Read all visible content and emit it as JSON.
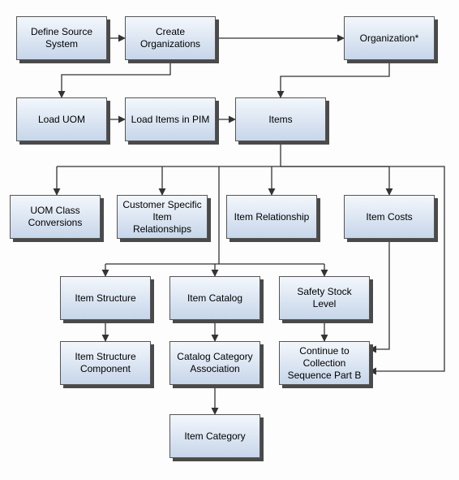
{
  "nodes": {
    "define_source_system": "Define Source System",
    "create_orgs": "Create Organizations",
    "organization": "Organization*",
    "load_uom": "Load UOM",
    "load_items_pim": "Load Items in PIM",
    "items": "Items",
    "uom_class_conv": "UOM Class Conversions",
    "cust_item_rel": "Customer Specific Item Relationships",
    "item_rel": "Item Relationship",
    "item_costs": "Item Costs",
    "item_structure": "Item Structure",
    "item_catalog": "Item Catalog",
    "safety_stock": "Safety Stock Level",
    "item_struct_comp": "Item Structure Component",
    "cat_cat_assoc": "Catalog Category Association",
    "continue_b": "Continue to Collection Sequence Part B",
    "item_category": "Item Category"
  },
  "chart_data": {
    "type": "flowchart",
    "boxes": [
      {
        "id": "define_source_system",
        "label": "Define Source System",
        "row": 1
      },
      {
        "id": "create_orgs",
        "label": "Create Organizations",
        "row": 1
      },
      {
        "id": "organization",
        "label": "Organization*",
        "row": 1
      },
      {
        "id": "load_uom",
        "label": "Load UOM",
        "row": 2
      },
      {
        "id": "load_items_pim",
        "label": "Load Items in PIM",
        "row": 2
      },
      {
        "id": "items",
        "label": "Items",
        "row": 2
      },
      {
        "id": "uom_class_conv",
        "label": "UOM Class Conversions",
        "row": 3
      },
      {
        "id": "cust_item_rel",
        "label": "Customer Specific Item Relationships",
        "row": 3
      },
      {
        "id": "item_rel",
        "label": "Item Relationship",
        "row": 3
      },
      {
        "id": "item_costs",
        "label": "Item Costs",
        "row": 3
      },
      {
        "id": "item_structure",
        "label": "Item Structure",
        "row": 4
      },
      {
        "id": "item_catalog",
        "label": "Item Catalog",
        "row": 4
      },
      {
        "id": "safety_stock",
        "label": "Safety Stock Level",
        "row": 4
      },
      {
        "id": "item_struct_comp",
        "label": "Item Structure Component",
        "row": 5
      },
      {
        "id": "cat_cat_assoc",
        "label": "Catalog Category Association",
        "row": 5
      },
      {
        "id": "continue_b",
        "label": "Continue to Collection Sequence Part B",
        "row": 5
      },
      {
        "id": "item_category",
        "label": "Item Category",
        "row": 6
      }
    ],
    "edges": [
      {
        "from": "define_source_system",
        "to": "create_orgs"
      },
      {
        "from": "create_orgs",
        "to": "organization"
      },
      {
        "from": "create_orgs",
        "to": "load_uom"
      },
      {
        "from": "organization",
        "to": "items"
      },
      {
        "from": "load_uom",
        "to": "load_items_pim"
      },
      {
        "from": "load_items_pim",
        "to": "items"
      },
      {
        "from": "items",
        "to": "uom_class_conv"
      },
      {
        "from": "items",
        "to": "cust_item_rel"
      },
      {
        "from": "items",
        "to": "item_rel"
      },
      {
        "from": "items",
        "to": "item_costs"
      },
      {
        "from": "items",
        "to": "item_structure",
        "via": "secondary_bus"
      },
      {
        "from": "items",
        "to": "item_catalog",
        "via": "secondary_bus"
      },
      {
        "from": "items",
        "to": "safety_stock",
        "via": "secondary_bus"
      },
      {
        "from": "items",
        "to": "continue_b",
        "via": "long_right"
      },
      {
        "from": "item_costs",
        "to": "continue_b"
      },
      {
        "from": "item_structure",
        "to": "item_struct_comp"
      },
      {
        "from": "item_catalog",
        "to": "cat_cat_assoc"
      },
      {
        "from": "safety_stock",
        "to": "continue_b"
      },
      {
        "from": "cat_cat_assoc",
        "to": "item_category"
      }
    ]
  }
}
